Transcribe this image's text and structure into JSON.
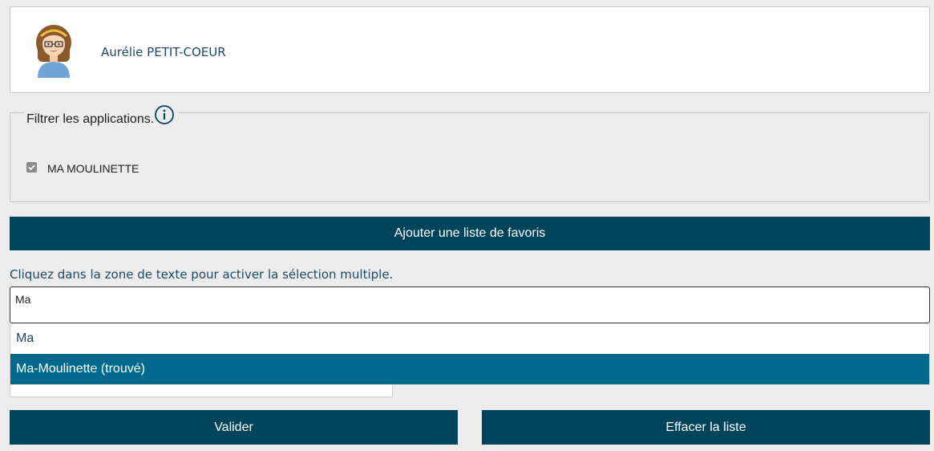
{
  "profile": {
    "name": "Aurélie PETIT-COEUR",
    "avatar_icon": "girl-avatar-icon"
  },
  "filter": {
    "legend": "Filtrer les applications.",
    "info_icon": "info-icon",
    "checkbox_label": "MA MOULINETTE",
    "checkbox_checked": true
  },
  "add_favorites_label": "Ajouter une liste de favoris",
  "hint": "Cliquez dans la zone de texte pour activer la sélection multiple.",
  "search": {
    "value": "Ma",
    "behind_placeholder": "...."
  },
  "dropdown": {
    "options": [
      {
        "label": "Ma",
        "active": false
      },
      {
        "label": "Ma-Moulinette (trouvé)",
        "active": true
      }
    ]
  },
  "actions": {
    "validate_label": "Valider",
    "clear_label": "Effacer la liste"
  },
  "colors": {
    "primary": "#01445c",
    "highlight": "#016a8c",
    "background": "#ececec",
    "text": "#1e4a63"
  }
}
